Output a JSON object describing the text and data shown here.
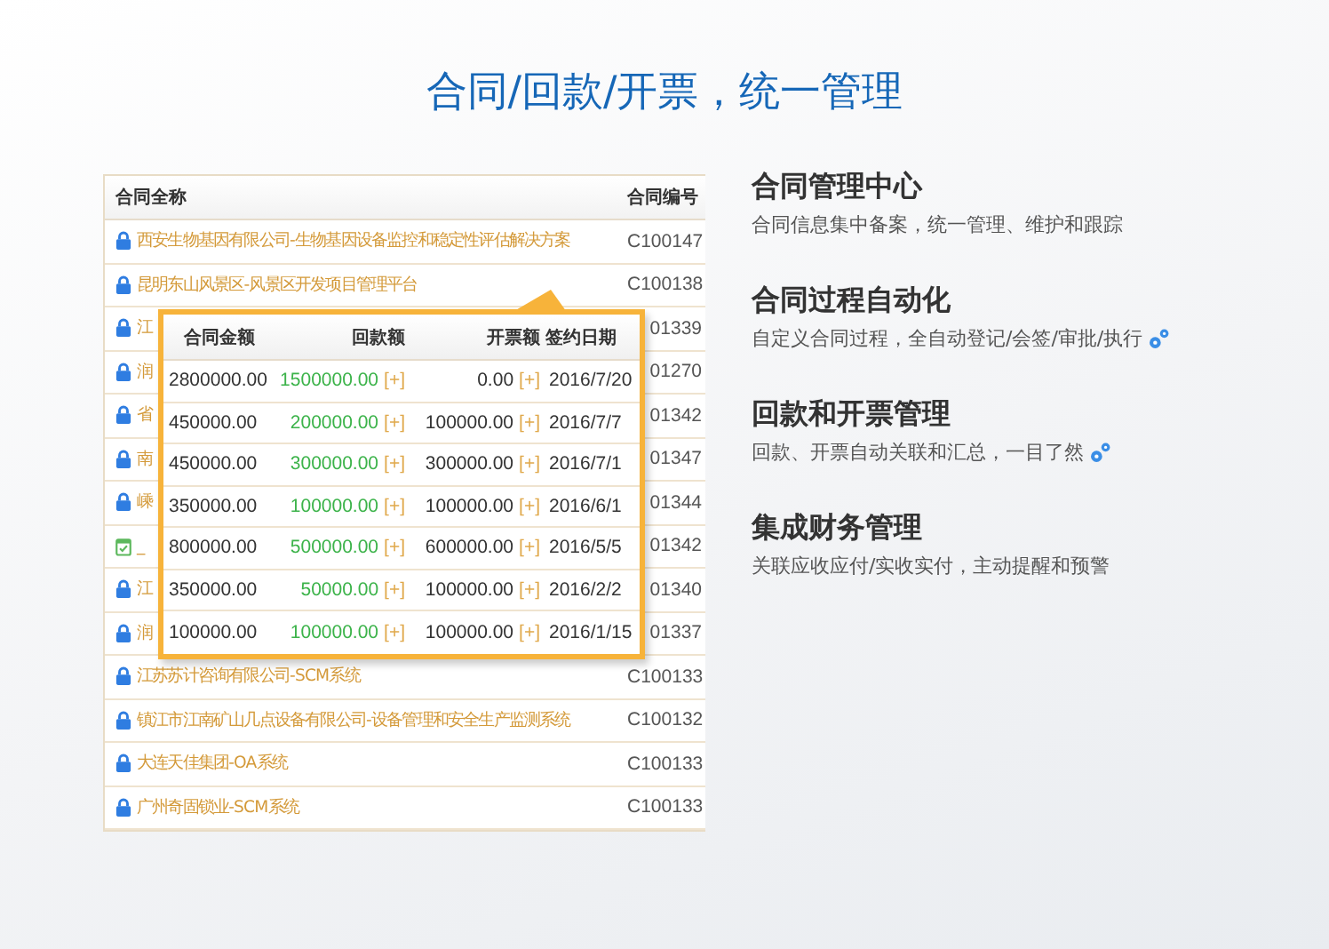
{
  "title": "合同/回款/开票，统一管理",
  "contracts": {
    "columns": [
      "合同全称",
      "合同编号"
    ],
    "rows": [
      {
        "kind": "lock",
        "name": "西安生物基因有限公司-生物基因设备监控和稳定性评估解决方案",
        "code": "C100147"
      },
      {
        "kind": "lock",
        "name": "昆明东山风景区-风景区开发项目管理平台",
        "code": "C100138"
      },
      {
        "kind": "lock",
        "name": "江",
        "code": "01339"
      },
      {
        "kind": "lock",
        "name": "润",
        "code": "01270"
      },
      {
        "kind": "lock",
        "name": "省",
        "code": "01342"
      },
      {
        "kind": "lock",
        "name": "南",
        "code": "01347"
      },
      {
        "kind": "lock",
        "name": "嵊",
        "code": "01344"
      },
      {
        "kind": "calendar",
        "name": "_",
        "code": "01342"
      },
      {
        "kind": "lock",
        "name": "江",
        "code": "01340"
      },
      {
        "kind": "lock",
        "name": "润",
        "code": "01337"
      },
      {
        "kind": "lock",
        "name": "江苏苏计咨询有限公司-SCM系统",
        "code": "C100133"
      },
      {
        "kind": "lock",
        "name": "镇江市江南矿山几点设备有限公司-设备管理和安全生产监测系统",
        "code": "C100132"
      },
      {
        "kind": "lock",
        "name": "大连天佳集团-OA系统",
        "code": "C100133"
      },
      {
        "kind": "lock",
        "name": "广州奇固锁业-SCM系统",
        "code": "C100133"
      }
    ]
  },
  "popup": {
    "columns": [
      "合同金额",
      "回款额",
      "开票额",
      "签约日期"
    ],
    "rows": [
      {
        "amount": "2800000.00",
        "received": "1500000.00",
        "received_add": "[+]",
        "invoiced": "0.00",
        "invoiced_add": "[+]",
        "date": "2016/7/20"
      },
      {
        "amount": "450000.00",
        "received": "200000.00",
        "received_add": "[+]",
        "invoiced": "100000.00",
        "invoiced_add": "[+]",
        "date": "2016/7/7"
      },
      {
        "amount": "450000.00",
        "received": "300000.00",
        "received_add": "[+]",
        "invoiced": "300000.00",
        "invoiced_add": "[+]",
        "date": "2016/7/1"
      },
      {
        "amount": "350000.00",
        "received": "100000.00",
        "received_add": "[+]",
        "invoiced": "100000.00",
        "invoiced_add": "[+]",
        "date": "2016/6/1"
      },
      {
        "amount": "800000.00",
        "received": "500000.00",
        "received_add": "[+]",
        "invoiced": "600000.00",
        "invoiced_add": "[+]",
        "date": "2016/5/5"
      },
      {
        "amount": "350000.00",
        "received": "50000.00",
        "received_add": "[+]",
        "invoiced": "100000.00",
        "invoiced_add": "[+]",
        "date": "2016/2/2"
      },
      {
        "amount": "100000.00",
        "received": "100000.00",
        "received_add": "[+]",
        "invoiced": "100000.00",
        "invoiced_add": "[+]",
        "date": "2016/1/15"
      }
    ]
  },
  "features": [
    {
      "title": "合同管理中心",
      "description": "合同信息集中备案，统一管理、维护和跟踪",
      "gear": false
    },
    {
      "title": "合同过程自动化",
      "description": "自定义合同过程，全自动登记/会签/审批/执行",
      "gear": true
    },
    {
      "title": "回款和开票管理",
      "description": "回款、开票自动关联和汇总，一目了然",
      "gear": true
    },
    {
      "title": "集成财务管理",
      "description": "关联应收应付/实收实付，主动提醒和预警",
      "gear": false
    }
  ]
}
